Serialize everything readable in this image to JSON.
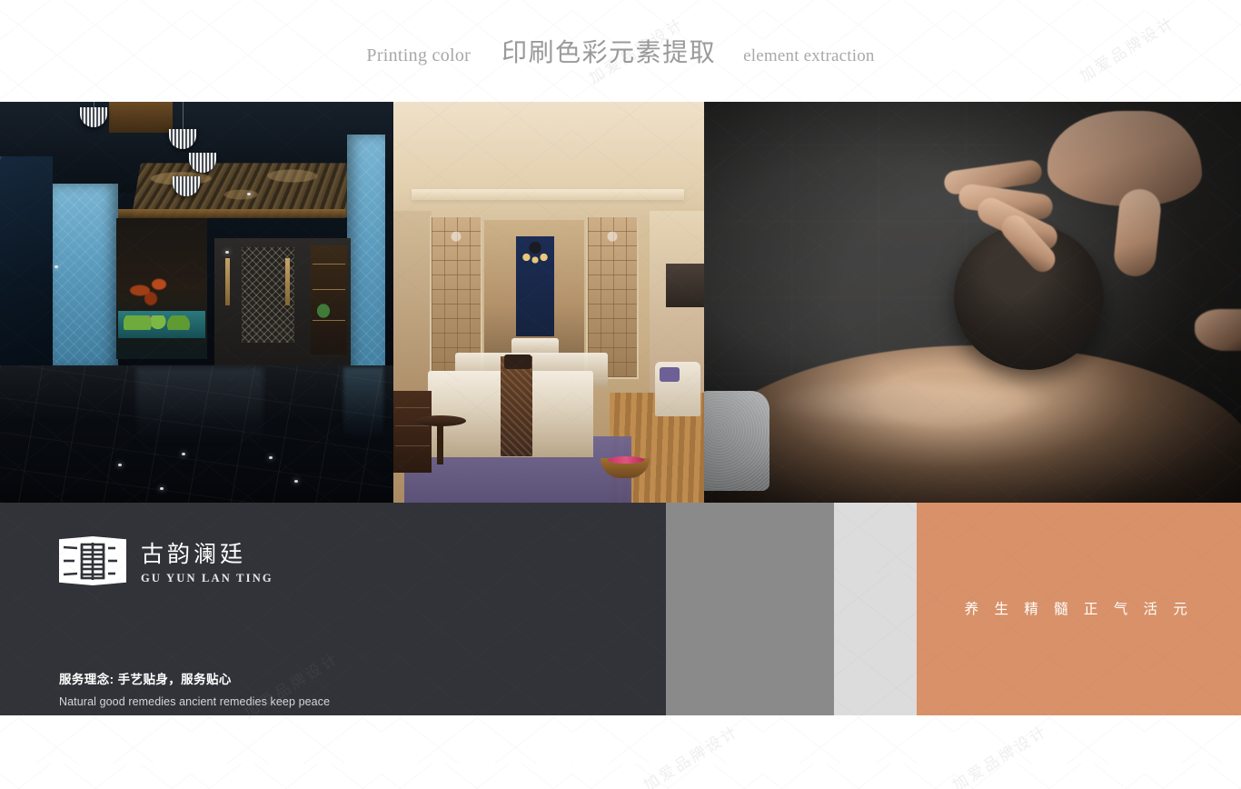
{
  "header": {
    "printing_color": "Printing color",
    "title_cn": "印刷色彩元素提取",
    "element_extraction": "element extraction"
  },
  "photos": [
    {
      "name": "spa-lobby-interior",
      "caption": "Dark blue spa lobby with illuminated blue textured wall panels, aquarium and polished black stone floor"
    },
    {
      "name": "treatment-room-interior",
      "caption": "Warm beige double massage treatment room with carved screens, purple rug and petal bowl"
    },
    {
      "name": "massage-therapy-closeup",
      "caption": "Dark moody close-up of a therapist hand rolling a black sphere over a back"
    }
  ],
  "brand": {
    "logo_cn": "古韵澜廷",
    "logo_en": "GU YUN LAN TING",
    "logo_mark_icon": "scroll-book-icon"
  },
  "tagline": {
    "cn": "服务理念: 手艺贴身，服务贴心",
    "en": "Natural good remedies ancient remedies keep peace"
  },
  "slogan": {
    "cn": "养 生 精 髓   正 气 活 元"
  },
  "swatches": [
    {
      "name": "dark-charcoal",
      "hex": "#313339"
    },
    {
      "name": "mid-gray",
      "hex": "#8a8a8a"
    },
    {
      "name": "light-gray",
      "hex": "#dcdcdc"
    },
    {
      "name": "terracotta-orange",
      "hex": "#d89168"
    }
  ],
  "watermark": {
    "text": "加爱品牌设计"
  }
}
